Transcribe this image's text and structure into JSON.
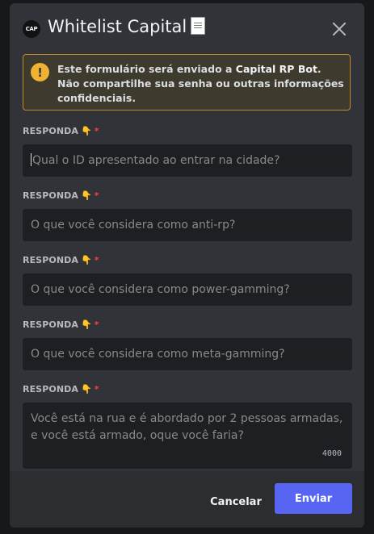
{
  "modal": {
    "app_avatar_text": "CAP",
    "title": "Whitelist Capital"
  },
  "warning": {
    "text_before": "Este formulário será enviado a ",
    "bot_name": "Capital RP Bot",
    "text_after": ". Não compartilhe sua senha ou outras informações confidenciais."
  },
  "fields": [
    {
      "label": "RESPONDA",
      "emoji": "👇",
      "required": "*",
      "placeholder": "Qual o ID apresentado ao entrar na cidade?"
    },
    {
      "label": "RESPONDA",
      "emoji": "👇",
      "required": "*",
      "placeholder": "O que você considera como anti-rp?"
    },
    {
      "label": "RESPONDA",
      "emoji": "👇",
      "required": "*",
      "placeholder": "O que você considera como power-gamming?"
    },
    {
      "label": "RESPONDA",
      "emoji": "👇",
      "required": "*",
      "placeholder": "O que você considera como meta-gamming?"
    },
    {
      "label": "RESPONDA",
      "emoji": "👇",
      "required": "*",
      "placeholder": "Você está na rua e é abordado por 2 pessoas armadas, e você está armado, oque você faria?",
      "max_length": "4000"
    }
  ],
  "footer": {
    "cancel_label": "Cancelar",
    "submit_label": "Enviar"
  },
  "colors": {
    "modal_bg": "#313338",
    "input_bg": "#1e1f22",
    "warning_border": "#c08a2c",
    "primary_button": "#5865f2",
    "required_star": "#f23f43"
  }
}
